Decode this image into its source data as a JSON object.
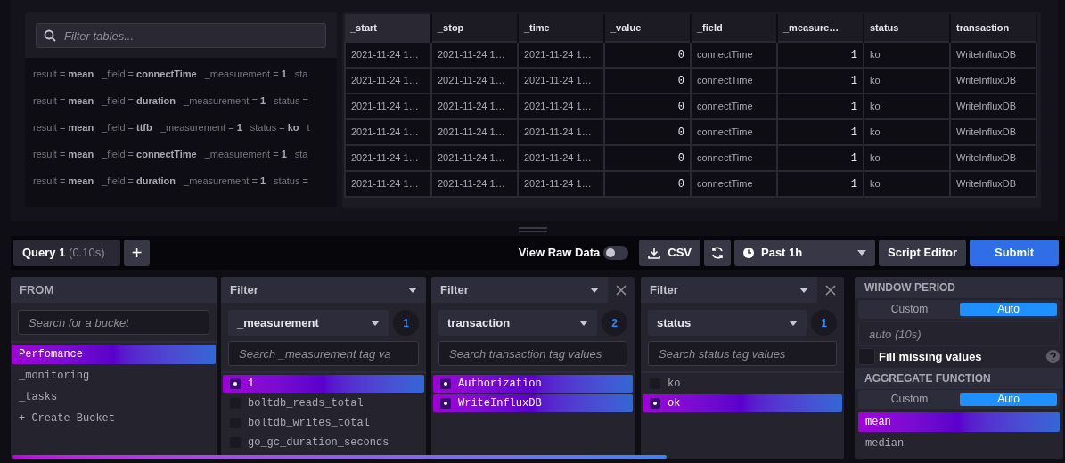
{
  "tables_panel": {
    "search": {
      "placeholder": "Filter tables..."
    },
    "rows": [
      {
        "pairs": [
          {
            "key": "result =",
            "value": "mean"
          },
          {
            "key": "_field =",
            "value": "connectTime"
          },
          {
            "key": "_measurement =",
            "value": "1"
          }
        ],
        "tail": "sta"
      },
      {
        "pairs": [
          {
            "key": "result =",
            "value": "mean"
          },
          {
            "key": "_field =",
            "value": "duration"
          },
          {
            "key": "_measurement =",
            "value": "1"
          }
        ],
        "tail": "status ="
      },
      {
        "pairs": [
          {
            "key": "result =",
            "value": "mean"
          },
          {
            "key": "_field =",
            "value": "ttfb"
          },
          {
            "key": "_measurement =",
            "value": "1"
          },
          {
            "key": "status =",
            "value": "ko"
          }
        ],
        "tail": "t"
      },
      {
        "pairs": [
          {
            "key": "result =",
            "value": "mean"
          },
          {
            "key": "_field =",
            "value": "connectTime"
          },
          {
            "key": "_measurement =",
            "value": "1"
          }
        ],
        "tail": "sta"
      },
      {
        "pairs": [
          {
            "key": "result =",
            "value": "mean"
          },
          {
            "key": "_field =",
            "value": "duration"
          },
          {
            "key": "_measurement =",
            "value": "1"
          }
        ],
        "tail": "status ="
      }
    ]
  },
  "table": {
    "columns": [
      {
        "label": "_start",
        "selected": true
      },
      {
        "label": "_stop",
        "selected": false
      },
      {
        "label": "_time",
        "selected": false
      },
      {
        "label": "_value",
        "selected": false
      },
      {
        "label": "_field",
        "selected": false
      },
      {
        "label": "_measure…",
        "selected": false
      },
      {
        "label": "status",
        "selected": false
      },
      {
        "label": "transaction",
        "selected": false
      }
    ],
    "rows": [
      [
        "2021-11-24 1…",
        "2021-11-24 1…",
        "2021-11-24 1…",
        "0",
        "connectTime",
        "1",
        "ko",
        "WriteInfluxDB"
      ],
      [
        "2021-11-24 1…",
        "2021-11-24 1…",
        "2021-11-24 1…",
        "0",
        "connectTime",
        "1",
        "ko",
        "WriteInfluxDB"
      ],
      [
        "2021-11-24 1…",
        "2021-11-24 1…",
        "2021-11-24 1…",
        "0",
        "connectTime",
        "1",
        "ko",
        "WriteInfluxDB"
      ],
      [
        "2021-11-24 1…",
        "2021-11-24 1…",
        "2021-11-24 1…",
        "0",
        "connectTime",
        "1",
        "ko",
        "WriteInfluxDB"
      ],
      [
        "2021-11-24 1…",
        "2021-11-24 1…",
        "2021-11-24 1…",
        "0",
        "connectTime",
        "1",
        "ko",
        "WriteInfluxDB"
      ],
      [
        "2021-11-24 1…",
        "2021-11-24 1…",
        "2021-11-24 1…",
        "0",
        "connectTime",
        "1",
        "ko",
        "WriteInfluxDB"
      ]
    ]
  },
  "toolbar": {
    "query_tab": {
      "label": "Query 1",
      "time": "(0.10s)"
    },
    "add": "+",
    "raw_data": {
      "label": "View Raw Data",
      "on": false
    },
    "csv": "CSV",
    "time_range": "Past 1h",
    "script_editor": "Script Editor",
    "submit": "Submit"
  },
  "from": {
    "title": "FROM",
    "search": {
      "placeholder": "Search for a bucket"
    },
    "buckets": [
      {
        "label": "Perfomance",
        "selected": true
      },
      {
        "label": "_monitoring",
        "selected": false
      },
      {
        "label": "_tasks",
        "selected": false
      },
      {
        "label": "+ Create Bucket",
        "selected": false
      }
    ]
  },
  "filters": [
    {
      "title": "Filter",
      "closable": false,
      "key": "_measurement",
      "count": "1",
      "search": {
        "placeholder": "Search _measurement tag va"
      },
      "values": [
        {
          "label": "1",
          "checked": true
        },
        {
          "label": "boltdb_reads_total",
          "checked": false
        },
        {
          "label": "boltdb_writes_total",
          "checked": false
        },
        {
          "label": "go_gc_duration_seconds",
          "checked": false
        }
      ]
    },
    {
      "title": "Filter",
      "closable": true,
      "key": "transaction",
      "count": "2",
      "search": {
        "placeholder": "Search transaction tag values"
      },
      "values": [
        {
          "label": "Authorization",
          "checked": true
        },
        {
          "label": "WriteInfluxDB",
          "checked": true
        }
      ]
    },
    {
      "title": "Filter",
      "closable": true,
      "key": "status",
      "count": "1",
      "search": {
        "placeholder": "Search status tag values"
      },
      "values": [
        {
          "label": "ko",
          "checked": false
        },
        {
          "label": "ok",
          "checked": true
        }
      ]
    }
  ],
  "aggregate": {
    "window_title": "WINDOW PERIOD",
    "window_modes": [
      {
        "label": "Custom",
        "selected": false
      },
      {
        "label": "Auto",
        "selected": true
      }
    ],
    "window_field": {
      "placeholder": "auto (10s)"
    },
    "fill_missing": {
      "label": "Fill missing values",
      "checked": false
    },
    "function_title": "AGGREGATE FUNCTION",
    "function_modes": [
      {
        "label": "Custom",
        "selected": false
      },
      {
        "label": "Auto",
        "selected": true
      }
    ],
    "functions": [
      {
        "label": "mean",
        "selected": true
      },
      {
        "label": "median",
        "selected": false
      }
    ]
  }
}
